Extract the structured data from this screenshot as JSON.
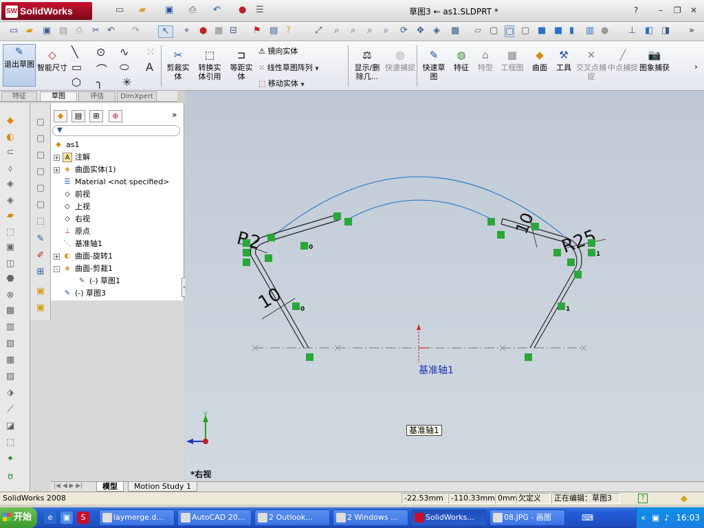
{
  "app": {
    "logo_text": "SolidWorks",
    "logo_badge": "SW",
    "document_title": "草图3 ← as1.SLDPRT *"
  },
  "window_controls": {
    "help": "?",
    "minimize": "–",
    "restore": "❐",
    "close": "✕"
  },
  "command_manager": {
    "exit_sketch": "退出草图",
    "smart_dimension": "智能尺寸",
    "trim": "剪裁实体",
    "convert": "转换实体引用",
    "offset": "等距实体",
    "mirror": "镜向实体",
    "linear_pattern": "线性草图阵列",
    "move": "移动实体",
    "display_delete": "显示/删除几...",
    "quick_snaps": "快速捕捉",
    "rapid_sketch": "快速草图",
    "features": "特征",
    "special_form": "特型",
    "drawing": "工程图",
    "surface": "曲面",
    "tools": "工具",
    "intersection_snap": "交叉点捕捉",
    "midpoint_snap": "中点捕捉",
    "image_capture": "图象捕获"
  },
  "cm_tabs": [
    "特征",
    "草图",
    "评估",
    "DimXpert"
  ],
  "tree": {
    "filter_icon": "funnel-icon",
    "root": "as1",
    "items": [
      {
        "label": "注解",
        "expand": "+"
      },
      {
        "label": "曲面实体(1)",
        "expand": "+"
      },
      {
        "label": "Material <not specified>",
        "expand": ""
      },
      {
        "label": "前视",
        "expand": ""
      },
      {
        "label": "上视",
        "expand": ""
      },
      {
        "label": "右视",
        "expand": ""
      },
      {
        "label": "原点",
        "expand": ""
      },
      {
        "label": "基准轴1",
        "expand": ""
      },
      {
        "label": "曲面-旋转1",
        "expand": "+"
      },
      {
        "label": "曲面-剪裁1",
        "expand": "–"
      },
      {
        "label": "(-) 草图1",
        "expand": ""
      },
      {
        "label": "(-) 草图3",
        "expand": ""
      }
    ]
  },
  "viewport": {
    "dim_r_left": "R2",
    "dim_r_right": "R25",
    "dim_len_left": "10",
    "dim_len_right": "10",
    "axis_label": "基准轴1",
    "axis_tooltip": "基准轴1",
    "view_name": "*右视",
    "badge_zero": "0",
    "badge_one": "1",
    "triad_y": "Y"
  },
  "bottom_tabs": [
    "模型",
    "Motion Study 1"
  ],
  "status": {
    "app": "SolidWorks 2008",
    "x": "-22.53mm",
    "y": "-110.33mm",
    "z": "0mm",
    "state": "欠定义",
    "editing": "正在编辑：草图3"
  },
  "taskbar": {
    "start": "开始",
    "tasks": [
      "laymerge.d...",
      "AutoCAD 20...",
      "2 Outlook...",
      "2 Windows ...",
      "SolidWorks...",
      "08.JPG - 画图"
    ],
    "clock": "16:03"
  },
  "colors": {
    "accent": "#245edb",
    "sketch_curve": "#2070c0",
    "relation_green": "#2aa63a",
    "title_red": "#c8102e"
  }
}
